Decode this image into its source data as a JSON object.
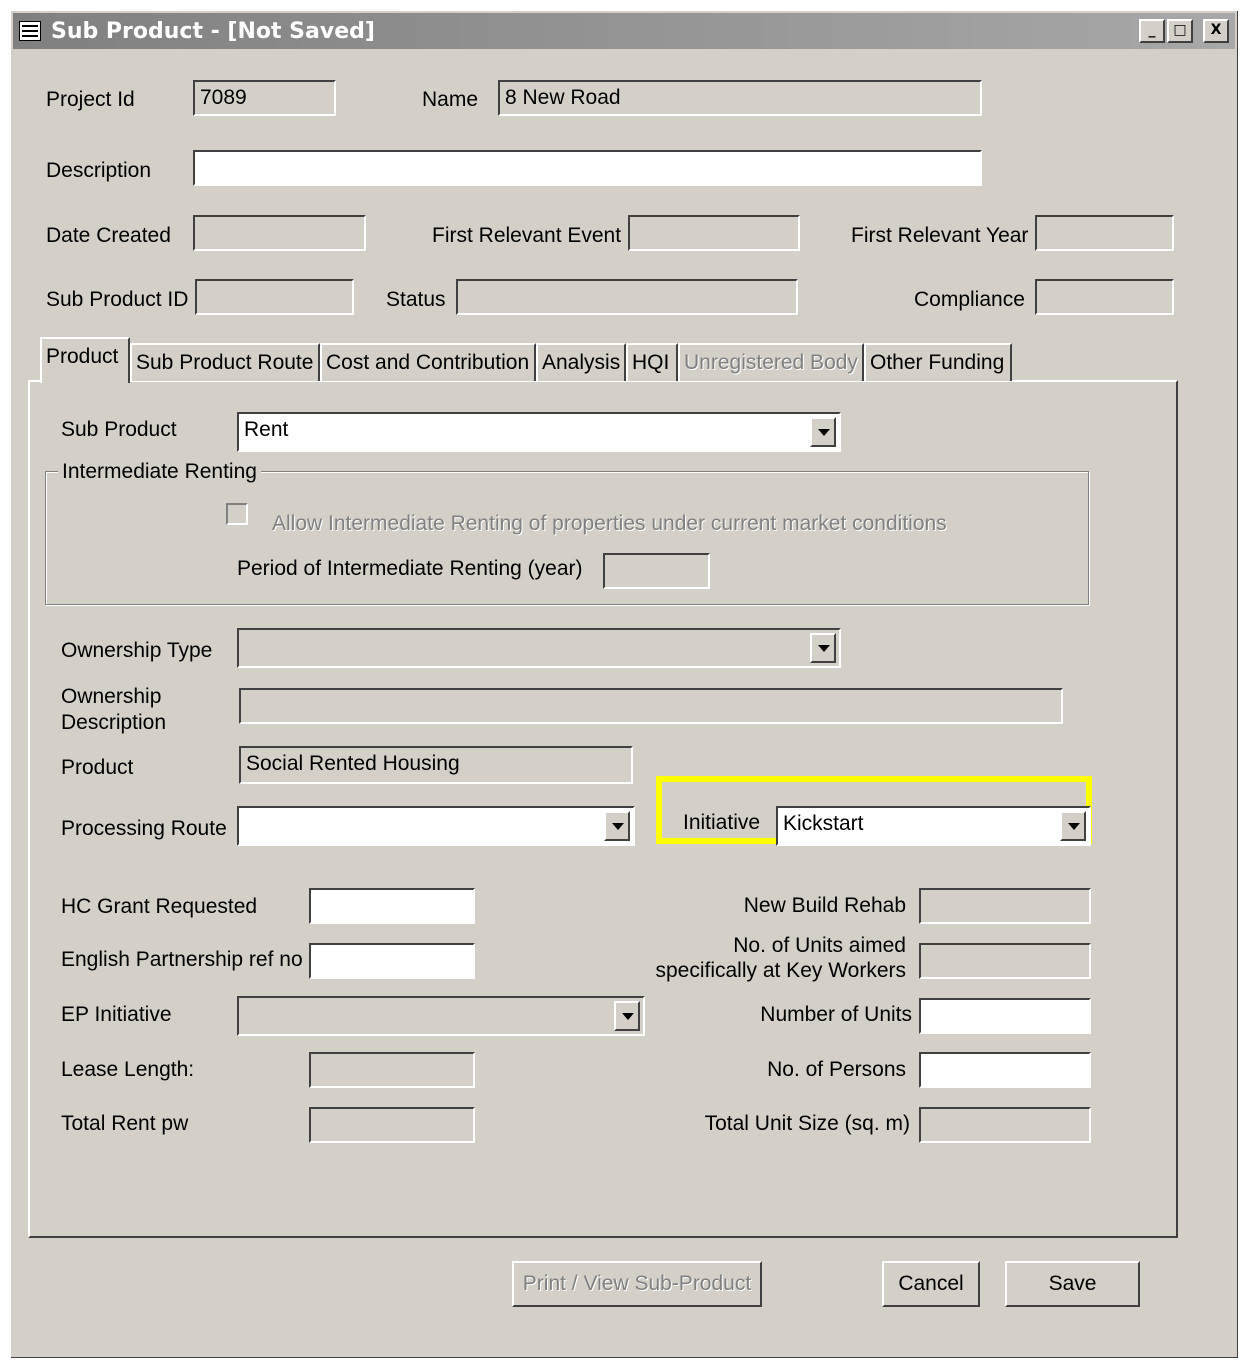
{
  "window": {
    "title": "Sub Product - [Not Saved]",
    "controls": {
      "minimize": "_",
      "maximize": "□",
      "close": "X"
    }
  },
  "header": {
    "project_id_label": "Project Id",
    "project_id_value": "7089",
    "name_label": "Name",
    "name_value": "8 New Road",
    "description_label": "Description",
    "description_value": "",
    "date_created_label": "Date Created",
    "first_event_label": "First Relevant Event",
    "first_year_label": "First Relevant Year",
    "sub_product_id_label": "Sub Product ID",
    "status_label": "Status",
    "compliance_label": "Compliance"
  },
  "tabs": [
    {
      "label": "Product",
      "active": true
    },
    {
      "label": "Sub Product Route"
    },
    {
      "label": "Cost and Contribution"
    },
    {
      "label": "Analysis"
    },
    {
      "label": "HQI"
    },
    {
      "label": "Unregistered Body",
      "disabled": true
    },
    {
      "label": "Other Funding"
    }
  ],
  "product_tab": {
    "sub_product_label": "Sub Product",
    "sub_product_value": "Rent",
    "intermediate_group_title": "Intermediate Renting",
    "allow_intermediate_label": "Allow Intermediate Renting of properties under current market conditions",
    "period_label": "Period of Intermediate Renting (year)",
    "ownership_type_label": "Ownership Type",
    "ownership_desc_label_1": "Ownership",
    "ownership_desc_label_2": "Description",
    "product_label": "Product",
    "product_value": "Social Rented Housing",
    "processing_route_label": "Processing Route",
    "initiative_label": "Initiative",
    "initiative_value": "Kickstart",
    "hc_grant_label": "HC Grant Requested",
    "ep_ref_label": "English Partnership ref no",
    "ep_initiative_label": "EP Initiative",
    "lease_length_label": "Lease Length:",
    "total_rent_label": "Total Rent pw",
    "new_build_label": "New Build Rehab",
    "key_workers_label_1": "No. of Units aimed",
    "key_workers_label_2": "specifically at Key Workers",
    "num_units_label": "Number of Units",
    "num_persons_label": "No. of Persons",
    "total_unit_size_label": "Total Unit Size (sq. m)"
  },
  "buttons": {
    "print": "Print / View Sub-Product",
    "cancel": "Cancel",
    "save": "Save"
  },
  "colors": {
    "highlight": "#ffff00",
    "face": "#d4d0c8"
  }
}
